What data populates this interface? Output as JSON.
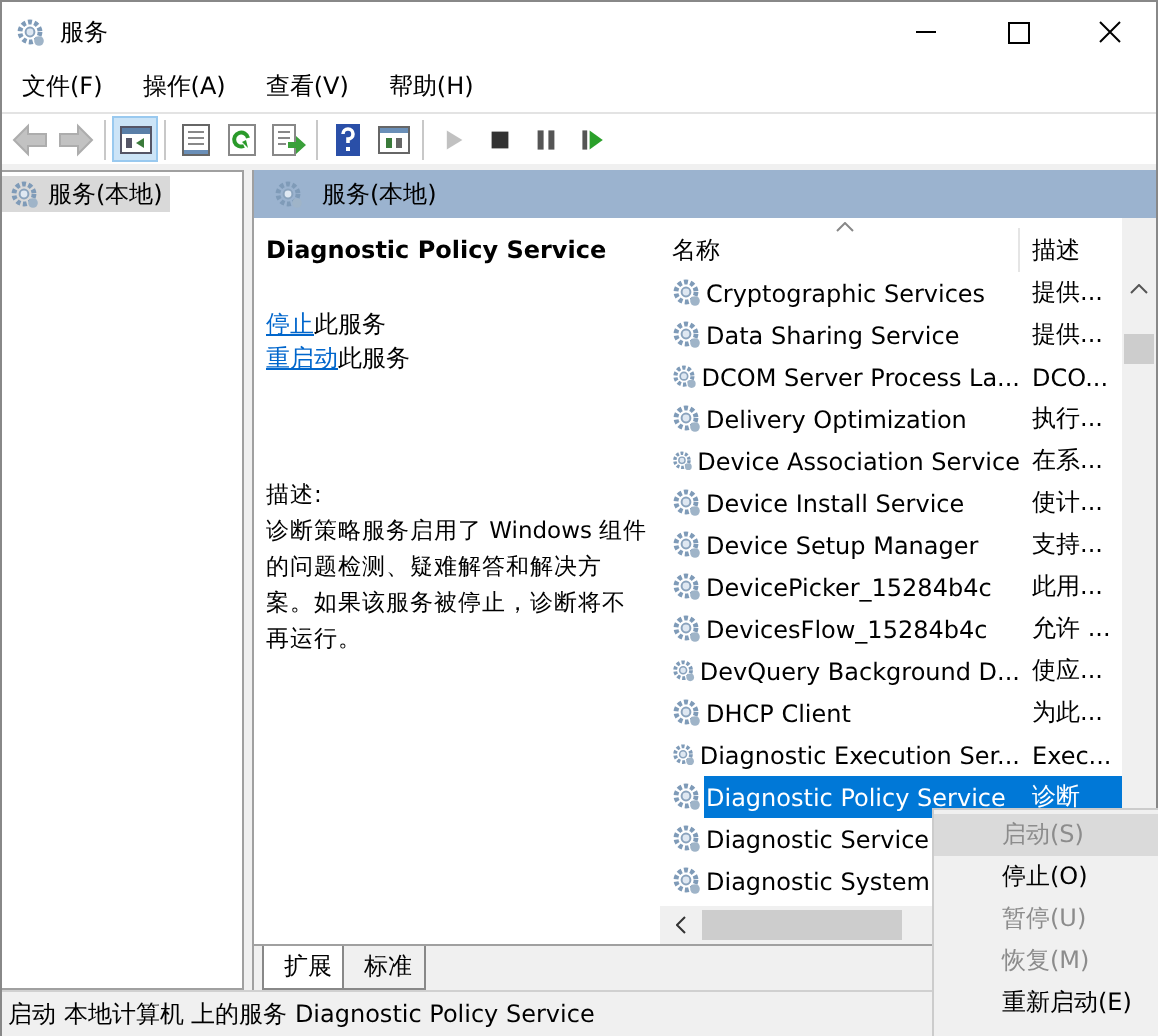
{
  "window": {
    "title": "服务"
  },
  "menu_bar": [
    "文件(F)",
    "操作(A)",
    "查看(V)",
    "帮助(H)"
  ],
  "toolbar": [
    {
      "kind": "back",
      "disabled": true
    },
    {
      "kind": "forward",
      "disabled": true
    },
    {
      "kind": "sep"
    },
    {
      "kind": "pane",
      "selected": true
    },
    {
      "kind": "sep"
    },
    {
      "kind": "props"
    },
    {
      "kind": "refresh"
    },
    {
      "kind": "export"
    },
    {
      "kind": "sep"
    },
    {
      "kind": "help"
    },
    {
      "kind": "view"
    },
    {
      "kind": "sep"
    },
    {
      "kind": "play",
      "disabled": true
    },
    {
      "kind": "stop"
    },
    {
      "kind": "pause"
    },
    {
      "kind": "resume"
    }
  ],
  "tree": {
    "items": [
      {
        "label": "服务(本地)",
        "selected": true
      }
    ]
  },
  "header": {
    "title": "服务(本地)"
  },
  "details": {
    "service_name": "Diagnostic Policy Service",
    "actions": [
      {
        "link": "停止",
        "text": "此服务"
      },
      {
        "link": "重启动",
        "text": "此服务"
      }
    ],
    "description_label": "描述:",
    "description": "诊断策略服务启用了 Windows 组件的问题检测、疑难解答和解决方案。如果该服务被停止，诊断将不再运行。"
  },
  "table": {
    "columns": [
      "名称",
      "描述"
    ],
    "rows": [
      {
        "name": "Cryptographic Services",
        "description": "提供...",
        "selected": false
      },
      {
        "name": "Data Sharing Service",
        "description": "提供...",
        "selected": false
      },
      {
        "name": "DCOM Server Process La...",
        "description": "DCO...",
        "selected": false
      },
      {
        "name": "Delivery Optimization",
        "description": "执行...",
        "selected": false
      },
      {
        "name": "Device Association Service",
        "description": "在系...",
        "selected": false
      },
      {
        "name": "Device Install Service",
        "description": "使计...",
        "selected": false
      },
      {
        "name": "Device Setup Manager",
        "description": "支持...",
        "selected": false
      },
      {
        "name": "DevicePicker_15284b4c",
        "description": "此用...",
        "selected": false
      },
      {
        "name": "DevicesFlow_15284b4c",
        "description": "允许 ...",
        "selected": false
      },
      {
        "name": "DevQuery Background D...",
        "description": "使应...",
        "selected": false
      },
      {
        "name": "DHCP Client",
        "description": "为此...",
        "selected": false
      },
      {
        "name": "Diagnostic Execution Ser...",
        "description": "Exec...",
        "selected": false
      },
      {
        "name": "Diagnostic Policy Service",
        "description": "诊断",
        "selected": true
      },
      {
        "name": "Diagnostic Service",
        "selected": false
      },
      {
        "name": "Diagnostic System",
        "selected": false
      }
    ]
  },
  "view_tabs": [
    {
      "label": "扩展",
      "selected": true
    },
    {
      "label": "标准",
      "selected": false
    }
  ],
  "context_menu": [
    {
      "label": "启动(S)",
      "disabled": true,
      "selected": true
    },
    {
      "label": "停止(O)",
      "disabled": false,
      "selected": false
    },
    {
      "label": "暂停(U)",
      "disabled": true,
      "selected": false
    },
    {
      "label": "恢复(M)",
      "disabled": true,
      "selected": false
    },
    {
      "label": "重新启动(E)",
      "disabled": false,
      "selected": false
    }
  ],
  "status_bar": "启动 本地计算机 上的服务 Diagnostic Policy Service"
}
